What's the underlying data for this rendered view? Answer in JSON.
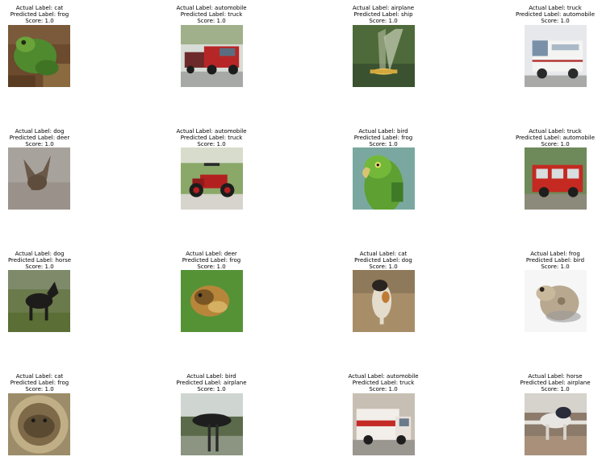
{
  "figure": {
    "prefix_actual": "Actual Label: ",
    "prefix_predicted": "Predicted Label: ",
    "prefix_score": "Score: "
  },
  "samples": [
    {
      "actual": "cat",
      "predicted": "frog",
      "score": "1.0",
      "image": "frog-photo"
    },
    {
      "actual": "automobile",
      "predicted": "truck",
      "score": "1.0",
      "image": "red-pickup-truck-photo"
    },
    {
      "actual": "airplane",
      "predicted": "ship",
      "score": "1.0",
      "image": "airplane-light-beams-photo"
    },
    {
      "actual": "truck",
      "predicted": "automobile",
      "score": "1.0",
      "image": "white-van-photo"
    },
    {
      "actual": "dog",
      "predicted": "deer",
      "score": "1.0",
      "image": "dog-silhouette-photo"
    },
    {
      "actual": "automobile",
      "predicted": "truck",
      "score": "1.0",
      "image": "antique-red-car-photo"
    },
    {
      "actual": "bird",
      "predicted": "frog",
      "score": "1.0",
      "image": "green-parrot-photo"
    },
    {
      "actual": "truck",
      "predicted": "automobile",
      "score": "1.0",
      "image": "red-vw-van-photo"
    },
    {
      "actual": "dog",
      "predicted": "horse",
      "score": "1.0",
      "image": "black-dog-on-grass-photo"
    },
    {
      "actual": "deer",
      "predicted": "frog",
      "score": "1.0",
      "image": "animal-on-grass-photo"
    },
    {
      "actual": "cat",
      "predicted": "dog",
      "score": "1.0",
      "image": "calico-cat-photo"
    },
    {
      "actual": "frog",
      "predicted": "bird",
      "score": "1.0",
      "image": "toad-white-background-photo"
    },
    {
      "actual": "cat",
      "predicted": "frog",
      "score": "1.0",
      "image": "round-cat-photo"
    },
    {
      "actual": "bird",
      "predicted": "airplane",
      "score": "1.0",
      "image": "ostrich-photo"
    },
    {
      "actual": "automobile",
      "predicted": "truck",
      "score": "1.0",
      "image": "ambulance-photo"
    },
    {
      "actual": "horse",
      "predicted": "airplane",
      "score": "1.0",
      "image": "horse-jumper-photo"
    }
  ]
}
